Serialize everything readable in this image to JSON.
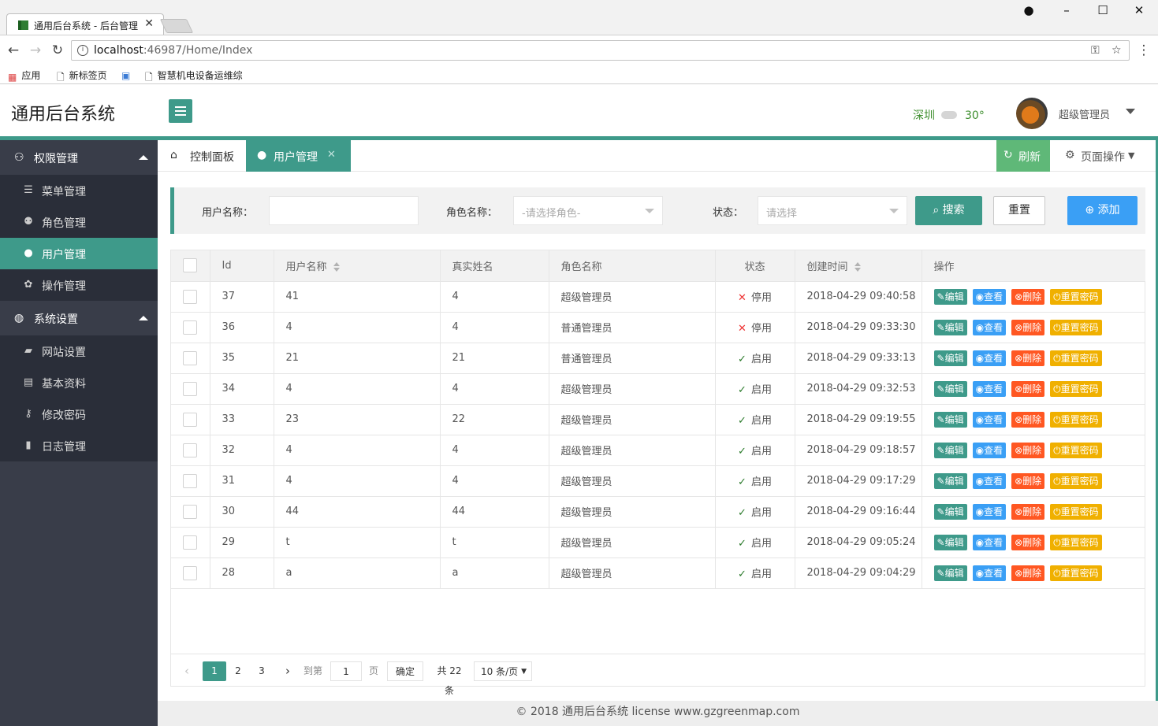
{
  "browser": {
    "tab_title": "通用后台系统 - 后台管理",
    "close": "✕",
    "url_host": "localhost",
    "url_rest": ":46987/Home/Index",
    "bookmarks": [
      "应用",
      "新标签页",
      "智慧机电设备运维综"
    ]
  },
  "header": {
    "logo": "通用后台系统",
    "city": "深圳",
    "temperature": "30°",
    "user_name": "超级管理员"
  },
  "sidebar": {
    "groups": [
      {
        "label": "权限管理",
        "items": [
          {
            "label": "菜单管理"
          },
          {
            "label": "角色管理"
          },
          {
            "label": "用户管理"
          },
          {
            "label": "操作管理"
          }
        ]
      },
      {
        "label": "系统设置",
        "items": [
          {
            "label": "网站设置"
          },
          {
            "label": "基本资料"
          },
          {
            "label": "修改密码"
          },
          {
            "label": "日志管理"
          }
        ]
      }
    ]
  },
  "tabs": {
    "home": "控制面板",
    "current": "用户管理",
    "refresh": "刷新",
    "page_ops": "页面操作"
  },
  "search": {
    "username_label": "用户名称：",
    "username_value": "",
    "role_label": "角色名称：",
    "role_placeholder": "-请选择角色-",
    "status_label": "状态：",
    "status_placeholder": "请选择",
    "search_btn": "搜索",
    "reset_btn": "重置",
    "add_btn": "添加"
  },
  "table": {
    "headers": [
      "Id",
      "用户名称",
      "真实姓名",
      "角色名称",
      "状态",
      "创建时间",
      "操作"
    ],
    "op_labels": {
      "edit": "编辑",
      "view": "查看",
      "delete": "删除",
      "reset": "重置密码"
    },
    "rows": [
      {
        "id": "37",
        "username": "41",
        "realname": "4",
        "role": "超级管理员",
        "status": "停用",
        "created": "2018-04-29 09:40:58"
      },
      {
        "id": "36",
        "username": "4",
        "realname": "4",
        "role": "普通管理员",
        "status": "停用",
        "created": "2018-04-29 09:33:30"
      },
      {
        "id": "35",
        "username": "21",
        "realname": "21",
        "role": "普通管理员",
        "status": "启用",
        "created": "2018-04-29 09:33:13"
      },
      {
        "id": "34",
        "username": "4",
        "realname": "4",
        "role": "超级管理员",
        "status": "启用",
        "created": "2018-04-29 09:32:53"
      },
      {
        "id": "33",
        "username": "23",
        "realname": "22",
        "role": "超级管理员",
        "status": "启用",
        "created": "2018-04-29 09:19:55"
      },
      {
        "id": "32",
        "username": "4",
        "realname": "4",
        "role": "超级管理员",
        "status": "启用",
        "created": "2018-04-29 09:18:57"
      },
      {
        "id": "31",
        "username": "4",
        "realname": "4",
        "role": "超级管理员",
        "status": "启用",
        "created": "2018-04-29 09:17:29"
      },
      {
        "id": "30",
        "username": "44",
        "realname": "44",
        "role": "超级管理员",
        "status": "启用",
        "created": "2018-04-29 09:16:44"
      },
      {
        "id": "29",
        "username": "t",
        "realname": "t",
        "role": "超级管理员",
        "status": "启用",
        "created": "2018-04-29 09:05:24"
      },
      {
        "id": "28",
        "username": "a",
        "realname": "a",
        "role": "超级管理员",
        "status": "启用",
        "created": "2018-04-29 09:04:29"
      }
    ]
  },
  "pager": {
    "pages": [
      "1",
      "2",
      "3"
    ],
    "current_page": "1",
    "goto_label": "到第",
    "goto_value": "1",
    "page_unit": "页",
    "confirm": "确定",
    "total": "共 22 条",
    "page_size": "10 条/页"
  },
  "footer": {
    "text": "© 2018 通用后台系统 license  www.gzgreenmap.com"
  },
  "colors": {
    "primary": "#3e9a8a",
    "sidebar": "#393d49",
    "sidebar_sub": "#2a2e39",
    "blue": "#3a9ff5",
    "danger": "#ff5722",
    "warn": "#f0b000"
  }
}
